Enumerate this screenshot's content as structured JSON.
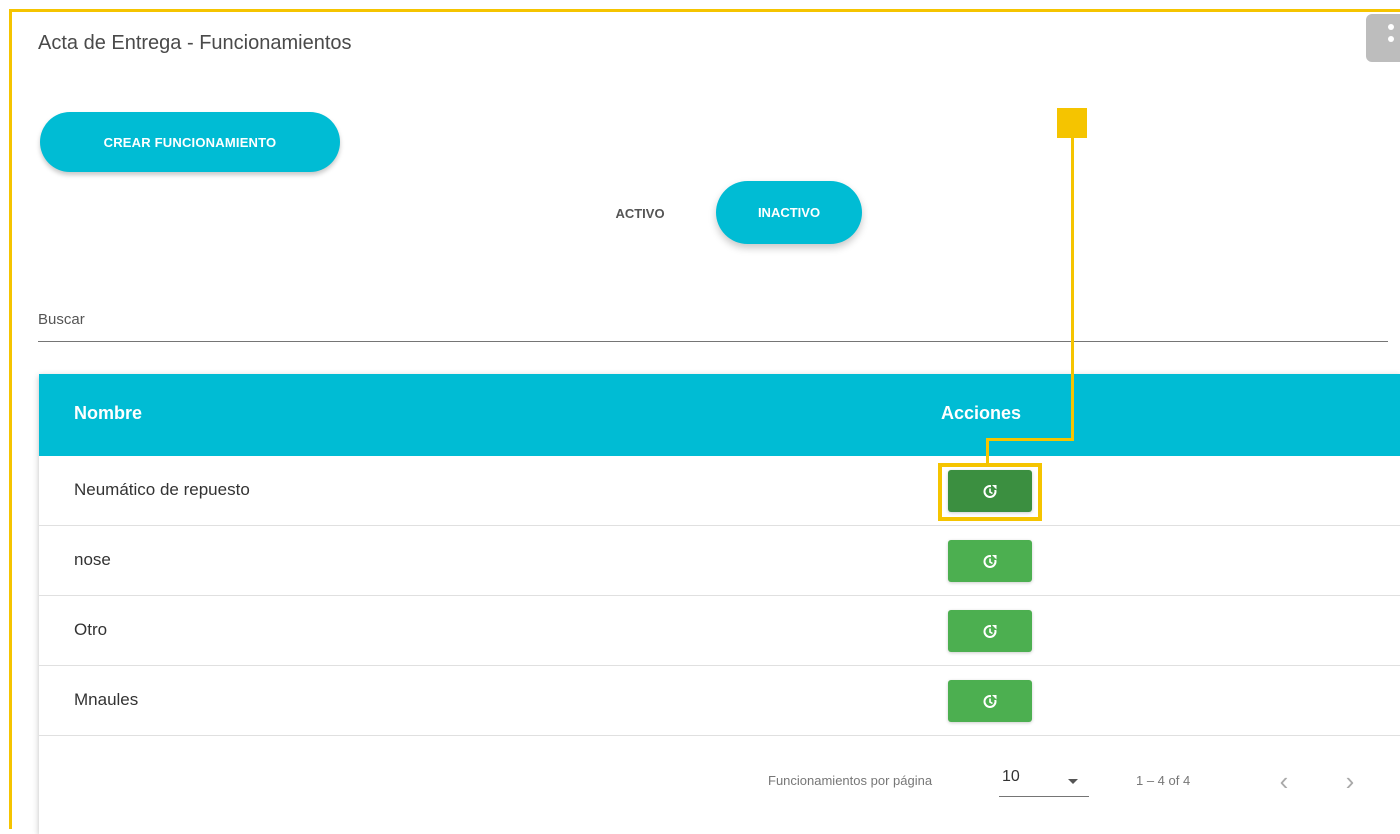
{
  "page": {
    "title": "Acta de Entrega - Funcionamientos",
    "create_button_label": "CREAR FUNCIONAMIENTO"
  },
  "tabs": [
    {
      "label": "ACTIVO",
      "selected": false
    },
    {
      "label": "INACTIVO",
      "selected": true
    }
  ],
  "search": {
    "placeholder": "Buscar",
    "value": ""
  },
  "table": {
    "columns": [
      "Nombre",
      "Acciones"
    ],
    "rows": [
      {
        "name": "Neumático de repuesto",
        "action_icon": "restore-icon"
      },
      {
        "name": "nose",
        "action_icon": "restore-icon"
      },
      {
        "name": "Otro",
        "action_icon": "restore-icon"
      },
      {
        "name": "Mnaules",
        "action_icon": "restore-icon"
      }
    ]
  },
  "pagination": {
    "items_per_page_label": "Funcionamientos por página",
    "items_per_page_value": "10",
    "range_label": "1 – 4 of 4"
  },
  "colors": {
    "accent": "#00bcd4",
    "action_button": "#4caf50",
    "highlight": "#f5c400"
  }
}
